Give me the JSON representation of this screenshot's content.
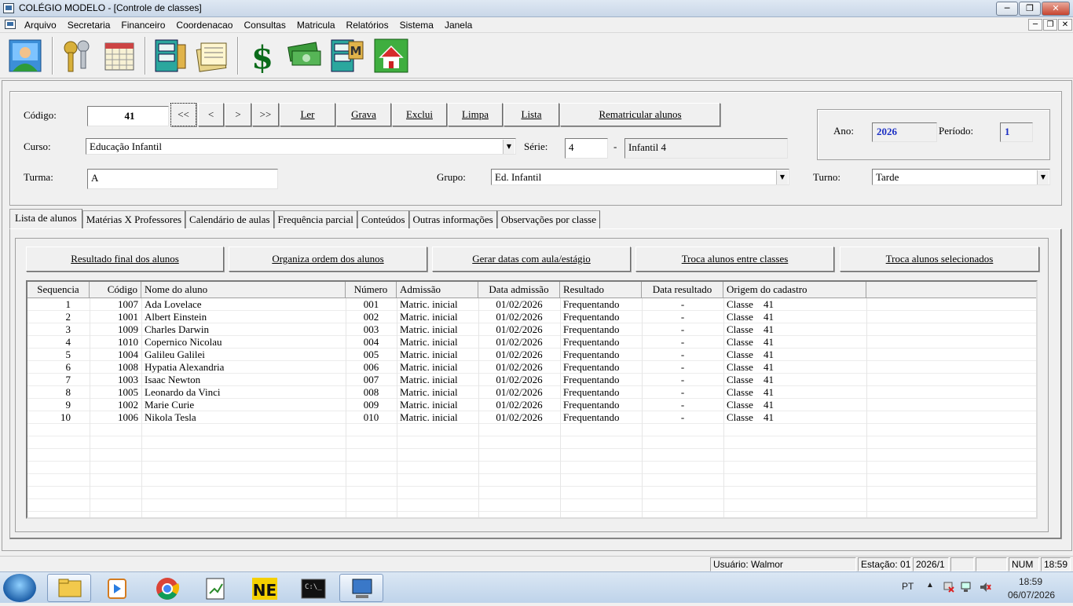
{
  "window": {
    "title": "COLÉGIO MODELO - [Controle de classes]"
  },
  "menu": [
    "Arquivo",
    "Secretaria",
    "Financeiro",
    "Coordenacao",
    "Consultas",
    "Matricula",
    "Relatórios",
    "Sistema",
    "Janela"
  ],
  "form": {
    "codigo_label": "Código:",
    "codigo_value": "41",
    "nav": [
      "<<",
      "<",
      ">",
      ">>"
    ],
    "actions": [
      "Ler",
      "Grava",
      "Exclui",
      "Limpa",
      "Lista"
    ],
    "rematricular": "Rematricular alunos",
    "curso_label": "Curso:",
    "curso_value": "Educação Infantil",
    "serie_label": "Série:",
    "serie_value": "4",
    "serie_dash": "-",
    "serie_desc": "Infantil 4",
    "turma_label": "Turma:",
    "turma_value": "A",
    "grupo_label": "Grupo:",
    "grupo_value": "Ed. Infantil",
    "turno_label": "Turno:",
    "turno_value": "Tarde",
    "ano_label": "Ano:",
    "ano_value": "2026",
    "periodo_label": "Período:",
    "periodo_value": "1"
  },
  "tabs": [
    "Lista de alunos",
    "Matérias X Professores",
    "Calendário de aulas",
    "Frequência parcial",
    "Conteúdos",
    "Outras informações",
    "Observações por classe"
  ],
  "actions": [
    "Resultado final dos alunos",
    "Organiza ordem dos alunos",
    "Gerar datas com aula/estágio",
    "Troca alunos entre classes",
    "Troca alunos selecionados"
  ],
  "grid": {
    "columns": [
      "Sequencia",
      "Código",
      "Nome do aluno",
      "Número",
      "Admissão",
      "Data admissão",
      "Resultado",
      "Data resultado",
      "Origem do cadastro"
    ],
    "rows": [
      [
        "1",
        "1007",
        "Ada Lovelace",
        "001",
        "Matric. inicial",
        "01/02/2026",
        "Frequentando",
        "-",
        "Classe    41"
      ],
      [
        "2",
        "1001",
        "Albert Einstein",
        "002",
        "Matric. inicial",
        "01/02/2026",
        "Frequentando",
        "-",
        "Classe    41"
      ],
      [
        "3",
        "1009",
        "Charles Darwin",
        "003",
        "Matric. inicial",
        "01/02/2026",
        "Frequentando",
        "-",
        "Classe    41"
      ],
      [
        "4",
        "1010",
        "Copernico Nicolau",
        "004",
        "Matric. inicial",
        "01/02/2026",
        "Frequentando",
        "-",
        "Classe    41"
      ],
      [
        "5",
        "1004",
        "Galileu Galilei",
        "005",
        "Matric. inicial",
        "01/02/2026",
        "Frequentando",
        "-",
        "Classe    41"
      ],
      [
        "6",
        "1008",
        "Hypatia Alexandria",
        "006",
        "Matric. inicial",
        "01/02/2026",
        "Frequentando",
        "-",
        "Classe    41"
      ],
      [
        "7",
        "1003",
        "Isaac Newton",
        "007",
        "Matric. inicial",
        "01/02/2026",
        "Frequentando",
        "-",
        "Classe    41"
      ],
      [
        "8",
        "1005",
        "Leonardo da Vinci",
        "008",
        "Matric. inicial",
        "01/02/2026",
        "Frequentando",
        "-",
        "Classe    41"
      ],
      [
        "9",
        "1002",
        "Marie Curie",
        "009",
        "Matric. inicial",
        "01/02/2026",
        "Frequentando",
        "-",
        "Classe    41"
      ],
      [
        "10",
        "1006",
        "Nikola Tesla",
        "010",
        "Matric. inicial",
        "01/02/2026",
        "Frequentando",
        "-",
        "Classe    41"
      ]
    ]
  },
  "status": {
    "usuario": "Usuário: Walmor",
    "estacao": "Estação: 01",
    "periodo": "2026/1",
    "num": "NUM",
    "hora": "18:59"
  },
  "taskbar": {
    "lang": "PT",
    "time": "18:59",
    "date": "06/07/2026"
  },
  "icons": {
    "toolbar": [
      "users-icon",
      "keys-icon",
      "calendar-icon",
      "file-cabinet-icon",
      "documents-icon",
      "dollar-icon",
      "money-icon",
      "cabinet-m-icon",
      "home-icon"
    ],
    "taskbar": [
      "start-icon",
      "explorer-icon",
      "media-player-icon",
      "chrome-icon",
      "notepad-icon",
      "nero-icon",
      "cmd-icon",
      "app-icon"
    ]
  },
  "colors": {
    "accent_value": "#1c2fc4",
    "dollar_green": "#0a6b1a"
  }
}
